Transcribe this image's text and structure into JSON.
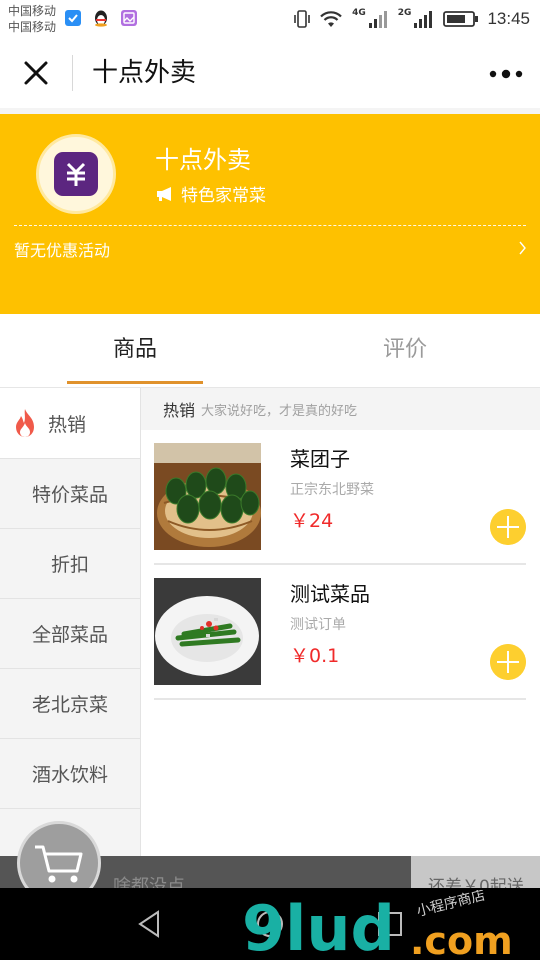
{
  "status_bar": {
    "carrier_1": "中国移动",
    "carrier_2": "中国移动",
    "net_4g": "4G",
    "net_2g": "2G",
    "time": "13:45"
  },
  "nav": {
    "title": "十点外卖",
    "close_icon": "close-icon",
    "more_icon": "more-dots-icon"
  },
  "shop": {
    "name": "十点外卖",
    "tag": "特色家常菜",
    "promo": "暂无优惠活动",
    "theme_color": "#fec100"
  },
  "tabs": [
    {
      "label": "商品",
      "active": true
    },
    {
      "label": "评价",
      "active": false
    }
  ],
  "categories": [
    {
      "label": "热销",
      "active": true,
      "icon": "fire-icon"
    },
    {
      "label": "特价菜品"
    },
    {
      "label": "折扣"
    },
    {
      "label": "全部菜品"
    },
    {
      "label": "老北京菜"
    },
    {
      "label": "酒水饮料"
    }
  ],
  "section": {
    "title": "热销",
    "subtitle": "大家说好吃，才是真的好吃"
  },
  "products": [
    {
      "name": "菜团子",
      "desc": "正宗东北野菜",
      "price": "￥24"
    },
    {
      "name": "测试菜品",
      "desc": "测试订单",
      "price": "￥0.1"
    }
  ],
  "cart": {
    "empty_text": "啥都没点",
    "min_text": "还差￥0起送"
  },
  "watermark": {
    "brand": "9lud",
    "domain": ".com",
    "slogan": "小程序商店"
  }
}
